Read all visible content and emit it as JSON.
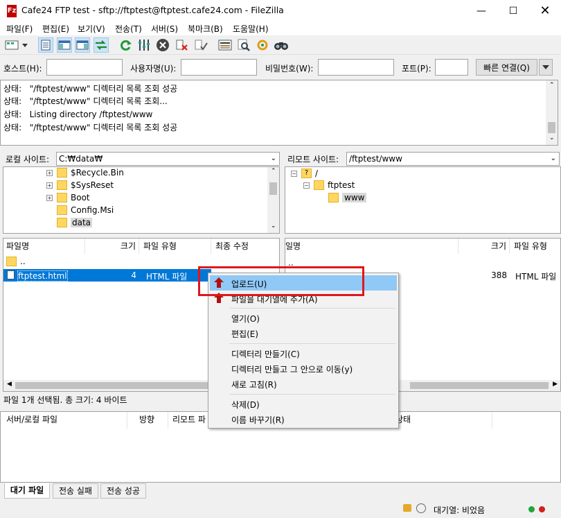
{
  "window": {
    "title": "Cafe24 FTP test - sftp://ftptest@ftptest.cafe24.com - FileZilla",
    "app_icon": "Fz"
  },
  "menu": [
    "파일(F)",
    "편집(E)",
    "보기(V)",
    "전송(T)",
    "서버(S)",
    "북마크(B)",
    "도움말(H)"
  ],
  "quickconnect": {
    "host_label": "호스트(H):",
    "user_label": "사용자명(U):",
    "pass_label": "비밀번호(W):",
    "port_label": "포트(P):",
    "connect_label": "빠른 연결(Q)",
    "host_value": "",
    "user_value": "",
    "pass_value": "",
    "port_value": ""
  },
  "log": [
    "상태:   \"/ftptest/www\" 디렉터리 목록 조회 성공",
    "상태:   \"/ftptest/www\" 디렉터리 목록 조회...",
    "상태:   Listing directory /ftptest/www",
    "상태:   \"/ftptest/www\" 디렉터리 목록 조회 성공"
  ],
  "local": {
    "site_label": "로컬 사이트:",
    "path": "C:₩data₩",
    "tree": [
      "$Recycle.Bin",
      "$SysReset",
      "Boot",
      "Config.Msi",
      "data"
    ],
    "columns": [
      "파일명",
      "크기",
      "파일 유형",
      "최종 수정"
    ],
    "files": [
      {
        "name": "..",
        "size": "",
        "type": ""
      },
      {
        "name": "ftptest.html",
        "size": "4",
        "type": "HTML 파일"
      }
    ],
    "status": "파일 1개 선택됨. 총 크기: 4 바이트"
  },
  "remote": {
    "site_label": "리모트 사이트:",
    "path": "/ftptest/www",
    "tree": [
      "/",
      "ftptest",
      "www"
    ],
    "columns": [
      "일명",
      "크기",
      "파일 유형"
    ],
    "files": [
      {
        "name": "..",
        "size": "",
        "type": ""
      },
      {
        "name": "",
        "size": "388",
        "type": "HTML 파일"
      }
    ]
  },
  "context_menu": {
    "upload": "업로드(U)",
    "add_queue": "파일을 대기열에 추가(A)",
    "open": "열기(O)",
    "edit": "편집(E)",
    "mkdir": "디렉터리 만들기(C)",
    "mkdir_enter": "디렉터리 만들고 그 안으로 이동(y)",
    "refresh": "새로 고침(R)",
    "delete": "삭제(D)",
    "rename": "이름 바꾸기(R)"
  },
  "queue": {
    "columns": [
      "서버/로컬 파일",
      "방향",
      "리모트 파",
      "상태"
    ]
  },
  "tabs": [
    "대기 파일",
    "전송 실패",
    "전송 성공"
  ],
  "statusbar": {
    "queue": "대기열: 비었음"
  },
  "colors": {
    "selection": "#0078d7",
    "highlight_box": "#e0161b",
    "menu_hover": "#cce8ff"
  }
}
